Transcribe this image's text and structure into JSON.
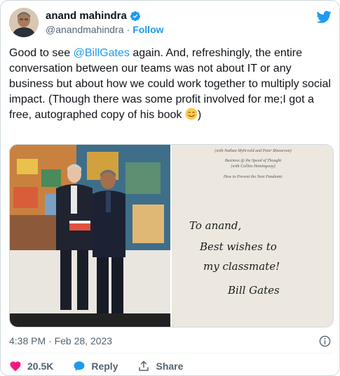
{
  "author": {
    "display_name": "anand mahindra",
    "handle": "@anandmahindra",
    "separator": "·",
    "follow_label": "Follow"
  },
  "tweet": {
    "text_before": "Good to see ",
    "mention": "@BillGates",
    "text_after": " again. And, refreshingly, the entire conversation between our teams was not about IT or any business but about how we could work together to multiply social impact. (Though there was some profit involved for me;I got a free, autographed copy of his book ",
    "text_end": ")",
    "emoji_name": "smiling-face-with-smiling-eyes"
  },
  "media": {
    "book_lines": [
      "(with Nathan Myhrvold and Peter Rinearson)",
      "Business @ the Speed of Thought",
      "(with Collins Hemingway)",
      "How to Prevent the Next Pandemic"
    ],
    "inscription_lines": [
      "To anand,",
      "Best wishes to",
      "my classmate!",
      "Bill Gates"
    ]
  },
  "meta": {
    "timestamp": "4:38 PM · Feb 28, 2023"
  },
  "actions": {
    "like_count": "20.5K",
    "reply_label": "Reply",
    "share_label": "Share"
  },
  "colors": {
    "accent": "#1d9bf0",
    "like": "#f91880",
    "text": "#0f1419",
    "muted": "#536471"
  }
}
